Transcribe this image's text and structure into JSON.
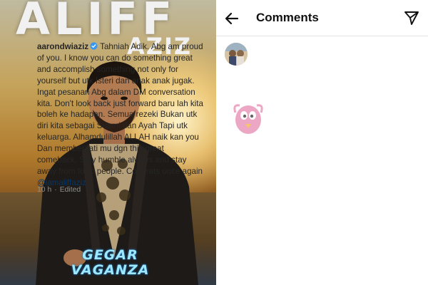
{
  "poster": {
    "title": "ALIFF",
    "subtitle": "AZIZ",
    "logo": "GEGAR VAGANZA"
  },
  "header": {
    "title": "Comments",
    "back_icon": "arrow-left-icon",
    "share_icon": "paper-plane-icon"
  },
  "comment": {
    "username": "aarondwiaziz",
    "verified": true,
    "text": "Tahniah Adik. Abg am proud of you. I know you can do something great and accomplish something not only for yourself but utk Isteri dan anak anak jugak. Ingat pesanan Abg dalam DM conversation kita. Don't look back just forward baru lah kita boleh ke hadapan. Semua rezeki Bukan utk diri kita sebagai Suami dan Ayah Tapi utk keluarga. Alhamdulillah ALLAH naik kan you Dan memberkati mu dgn this great comeback. Stay humble always and stay away from toxic people. Congrats once again ",
    "mention": "@iamaliffaziz",
    "time": "10 h",
    "separator": "·",
    "edited": "Edited"
  },
  "colors": {
    "text": "#262626",
    "muted": "#8e8e8e",
    "mention": "#00376b",
    "verified": "#3897f0"
  }
}
